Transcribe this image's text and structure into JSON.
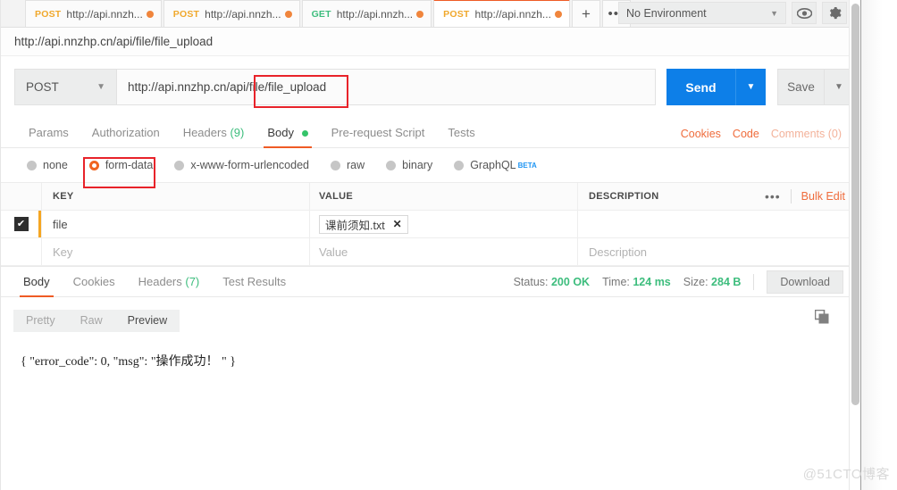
{
  "tabbar": {
    "tabs": [
      {
        "method": "POST",
        "url": "http://api.nnzh...",
        "active": false
      },
      {
        "method": "POST",
        "url": "http://api.nnzh...",
        "active": false
      },
      {
        "method": "GET",
        "url": "http://api.nnzh...",
        "active": false
      },
      {
        "method": "POST",
        "url": "http://api.nnzh...",
        "active": true
      }
    ],
    "new_tab_label": "+",
    "more_label": "•••",
    "environment": "No Environment",
    "eye_icon": "eye-icon",
    "gear_icon": "gear-icon"
  },
  "breadcrumb": {
    "title": "http://api.nnzhp.cn/api/file/file_upload"
  },
  "request": {
    "method": "POST",
    "url": "http://api.nnzhp.cn/api/file/file_upload",
    "send_label": "Send",
    "save_label": "Save",
    "tabs": [
      {
        "label": "Params",
        "active": false
      },
      {
        "label": "Authorization",
        "active": false
      },
      {
        "label": "Headers",
        "count": "(9)",
        "active": false
      },
      {
        "label": "Body",
        "active": true,
        "dot": true
      },
      {
        "label": "Pre-request Script",
        "active": false
      },
      {
        "label": "Tests",
        "active": false
      }
    ],
    "links": [
      {
        "label": "Cookies",
        "muted": false
      },
      {
        "label": "Code",
        "muted": false
      },
      {
        "label": "Comments (0)",
        "muted": true
      }
    ],
    "body_types": [
      {
        "label": "none",
        "checked": false
      },
      {
        "label": "form-data",
        "checked": true
      },
      {
        "label": "x-www-form-urlencoded",
        "checked": false
      },
      {
        "label": "raw",
        "checked": false
      },
      {
        "label": "binary",
        "checked": false
      },
      {
        "label": "GraphQL",
        "checked": false,
        "badge": "BETA"
      }
    ],
    "table": {
      "headers": {
        "key": "KEY",
        "value": "VALUE",
        "description": "DESCRIPTION"
      },
      "bulk_edit_label": "Bulk Edit",
      "more_label": "•••",
      "rows": [
        {
          "checked": true,
          "key": "file",
          "value_chip": "课前须知.txt",
          "chip_close": "✕",
          "description": ""
        }
      ],
      "placeholder_row": {
        "key": "Key",
        "value": "Value",
        "description": "Description"
      }
    }
  },
  "response": {
    "tabs": [
      {
        "label": "Body",
        "active": true
      },
      {
        "label": "Cookies",
        "active": false
      },
      {
        "label": "Headers",
        "count": "(7)",
        "active": false
      },
      {
        "label": "Test Results",
        "active": false
      }
    ],
    "meta": {
      "status_label": "Status:",
      "status_value": "200 OK",
      "time_label": "Time:",
      "time_value": "124 ms",
      "size_label": "Size:",
      "size_value": "284 B"
    },
    "download_label": "Download",
    "view_modes": [
      {
        "label": "Pretty",
        "active": false
      },
      {
        "label": "Raw",
        "active": false
      },
      {
        "label": "Preview",
        "active": true
      }
    ],
    "copy_icon": "copy-icon",
    "body_text": "{ \"error_code\": 0, \"msg\": \"操作成功！ \" }"
  },
  "watermark": "@51CTO博客",
  "colors": {
    "accent_orange": "#ef5b25",
    "send_blue": "#0d7fe8",
    "success_green": "#3dbd7d",
    "annotation_red": "#e8232a"
  }
}
